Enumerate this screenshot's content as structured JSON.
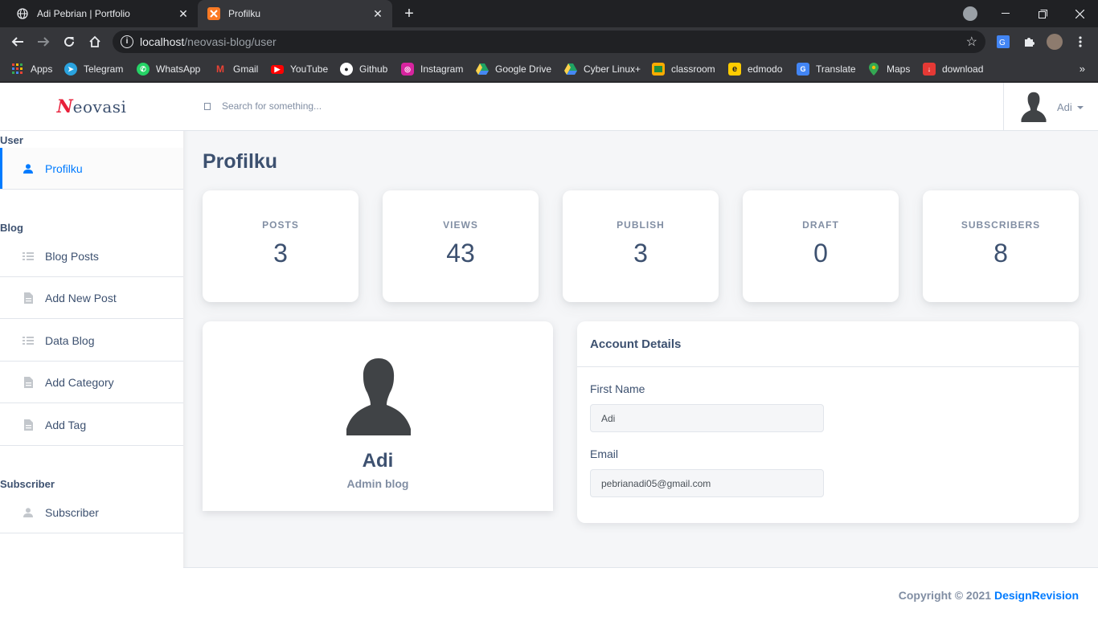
{
  "browser": {
    "tabs": [
      {
        "title": "Adi Pebrian | Portfolio",
        "close": "✕"
      },
      {
        "title": "Profilku",
        "close": "✕"
      }
    ],
    "new_tab": "+",
    "url_host": "localhost",
    "url_path": "/neovasi-blog/user",
    "bookmarks": [
      {
        "label": "Apps",
        "icon": "apps-grid-icon",
        "color": "#ea4335"
      },
      {
        "label": "Telegram",
        "icon": "telegram-icon",
        "color": "#2aa3df"
      },
      {
        "label": "WhatsApp",
        "icon": "whatsapp-icon",
        "color": "#25d366"
      },
      {
        "label": "Gmail",
        "icon": "gmail-icon",
        "color": "#ea4335"
      },
      {
        "label": "YouTube",
        "icon": "youtube-icon",
        "color": "#ff0000"
      },
      {
        "label": "Github",
        "icon": "github-icon",
        "color": "#ffffff"
      },
      {
        "label": "Instagram",
        "icon": "instagram-icon",
        "color": "#d6249f"
      },
      {
        "label": "Google Drive",
        "icon": "google-drive-icon",
        "color": "#1fa463"
      },
      {
        "label": "Cyber Linux+",
        "icon": "google-drive-icon",
        "color": "#1fa463"
      },
      {
        "label": "classroom",
        "icon": "classroom-icon",
        "color": "#f9ab00"
      },
      {
        "label": "edmodo",
        "icon": "edmodo-icon",
        "color": "#ffcc00"
      },
      {
        "label": "Translate",
        "icon": "translate-icon",
        "color": "#4285f4"
      },
      {
        "label": "Maps",
        "icon": "maps-pin-icon",
        "color": "#34a853"
      },
      {
        "label": "download",
        "icon": "download-icon",
        "color": "#e53935"
      }
    ],
    "more": "»"
  },
  "brand": {
    "first": "N",
    "rest": "eovasi"
  },
  "sidebar": {
    "sections": [
      {
        "title": "User"
      },
      {
        "title": "Blog"
      },
      {
        "title": "Subscriber"
      }
    ],
    "items": [
      {
        "label": "Profilku",
        "icon": "person-icon"
      },
      {
        "label": "Blog Posts",
        "icon": "list-icon"
      },
      {
        "label": "Add New Post",
        "icon": "document-icon"
      },
      {
        "label": "Data Blog",
        "icon": "list-icon"
      },
      {
        "label": "Add Category",
        "icon": "document-icon"
      },
      {
        "label": "Add Tag",
        "icon": "document-icon"
      },
      {
        "label": "Subscriber",
        "icon": "person-icon"
      }
    ]
  },
  "topbar": {
    "search_placeholder": "Search for something...",
    "user_name": "Adi"
  },
  "main": {
    "title": "Profilku",
    "stats": [
      {
        "label": "POSTS",
        "value": "3"
      },
      {
        "label": "VIEWS",
        "value": "43"
      },
      {
        "label": "PUBLISH",
        "value": "3"
      },
      {
        "label": "DRAFT",
        "value": "0"
      },
      {
        "label": "SUBSCRIBERS",
        "value": "8"
      }
    ],
    "profile": {
      "name": "Adi",
      "role": "Admin blog"
    },
    "account": {
      "title": "Account Details",
      "first_name_label": "First Name",
      "first_name_value": "Adi",
      "email_label": "Email",
      "email_value": "pebrianadi05@gmail.com"
    }
  },
  "footer": {
    "copyright": "Copyright © 2021 ",
    "link": "DesignRevision"
  },
  "colors": {
    "accent": "#007bff",
    "heading": "#3d5170",
    "muted": "#818ea3",
    "brand_red": "#e8203a"
  }
}
